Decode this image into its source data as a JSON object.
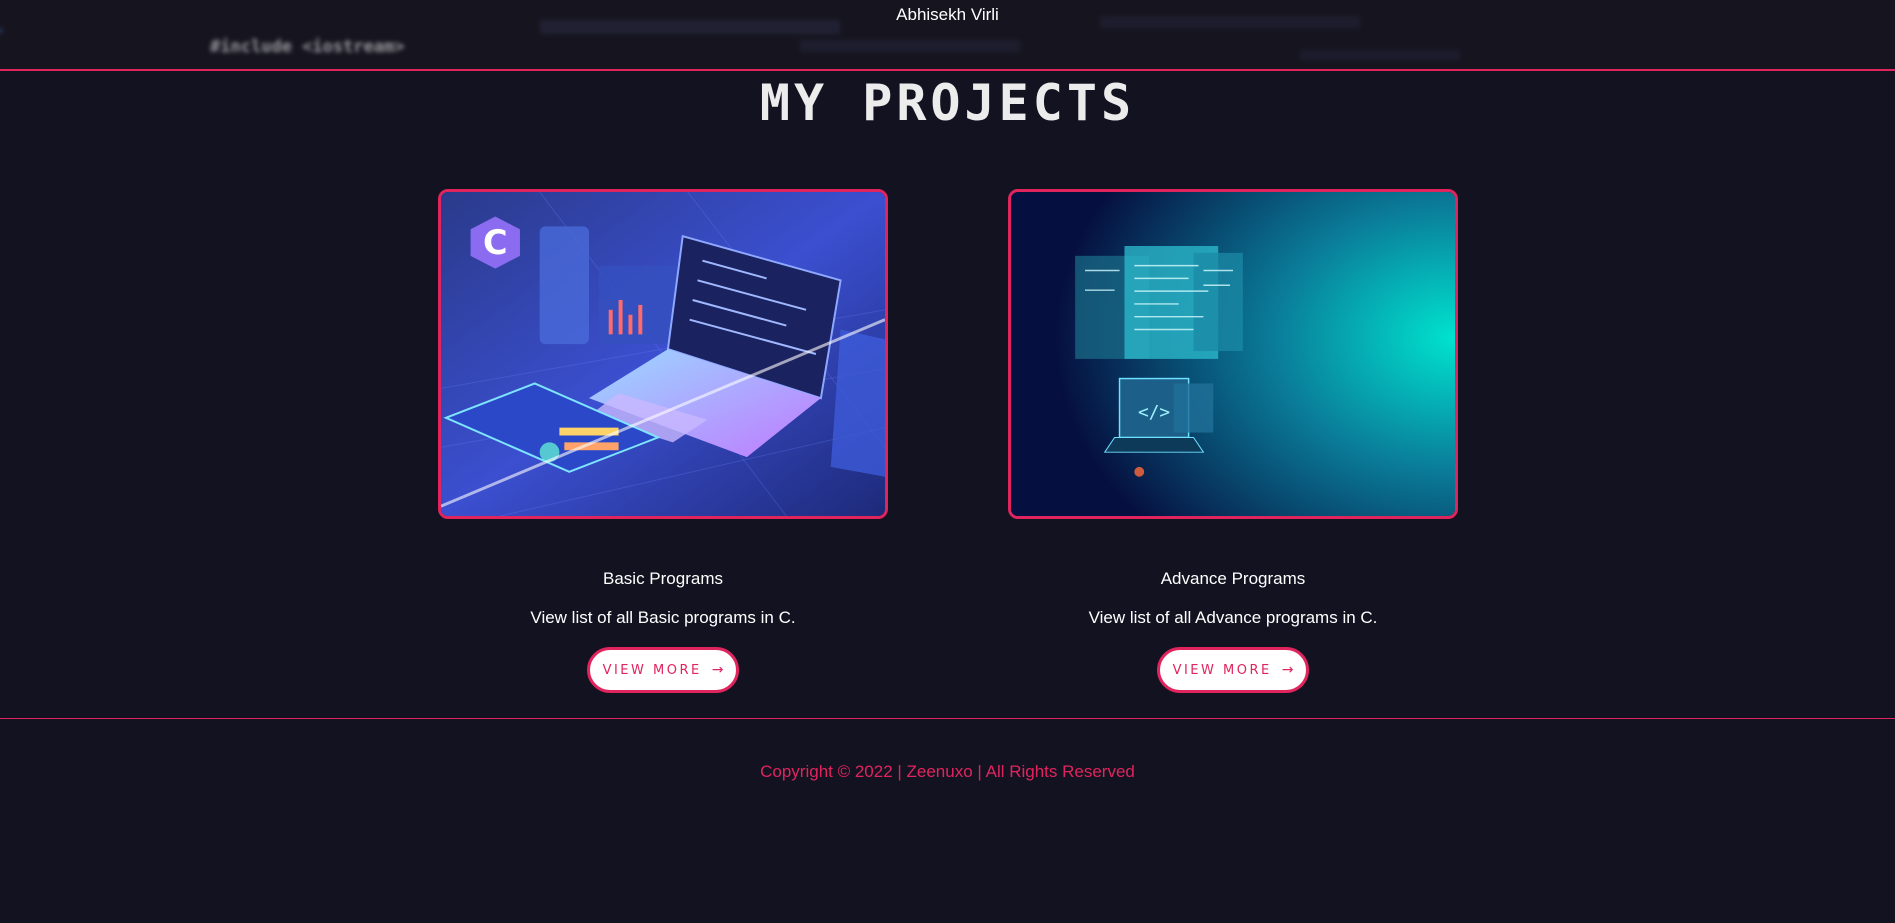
{
  "header": {
    "owner_name": "Abhisekh Virli",
    "bg_code_text": "#include <iostream>"
  },
  "page": {
    "title": "MY PROJECTS"
  },
  "projects": [
    {
      "title": "Basic Programs",
      "description": "View list of all Basic programs in C.",
      "button_label": "VIEW MORE",
      "button_icon": "→"
    },
    {
      "title": "Advance Programs",
      "description": "View list of all Advance programs in C.",
      "button_label": "VIEW MORE",
      "button_icon": "→"
    }
  ],
  "footer": {
    "copyright": "Copyright ©  2022 | Zeenuxo | All Rights Reserved"
  },
  "colors": {
    "accent": "#e0245e",
    "background": "#131220",
    "button_bg": "#ffffff"
  }
}
